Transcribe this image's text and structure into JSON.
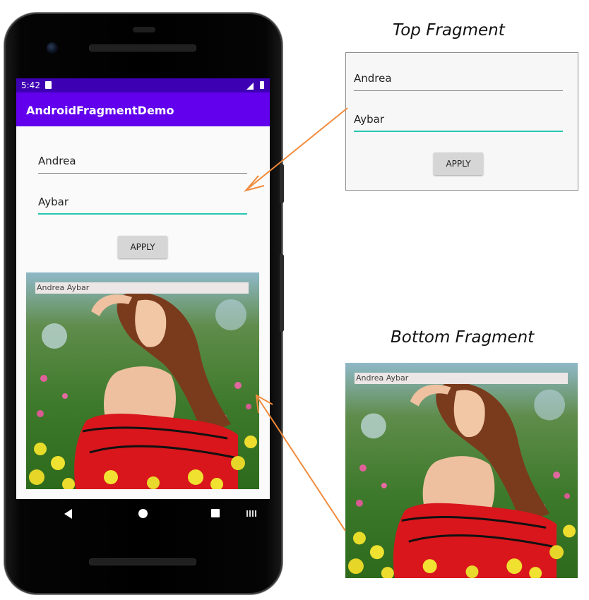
{
  "device": {
    "status_time": "5:42",
    "app_title": "AndroidFragmentDemo"
  },
  "top_fragment": {
    "first_name": "Andrea",
    "last_name": "Aybar",
    "apply_label": "APPLY"
  },
  "bottom_fragment": {
    "caption": "Andrea Aybar"
  },
  "annotations": {
    "top_heading": "Top Fragment",
    "bottom_heading": "Bottom Fragment"
  },
  "colors": {
    "status_bar": "#3e00b3",
    "app_bar": "#6200ee",
    "focus_underline": "#26c6b0",
    "arrow": "#f08a3c"
  },
  "icons": [
    "sd-card-icon",
    "signal-icon",
    "battery-icon",
    "back-icon",
    "home-icon",
    "recents-icon",
    "keyboard-icon"
  ]
}
